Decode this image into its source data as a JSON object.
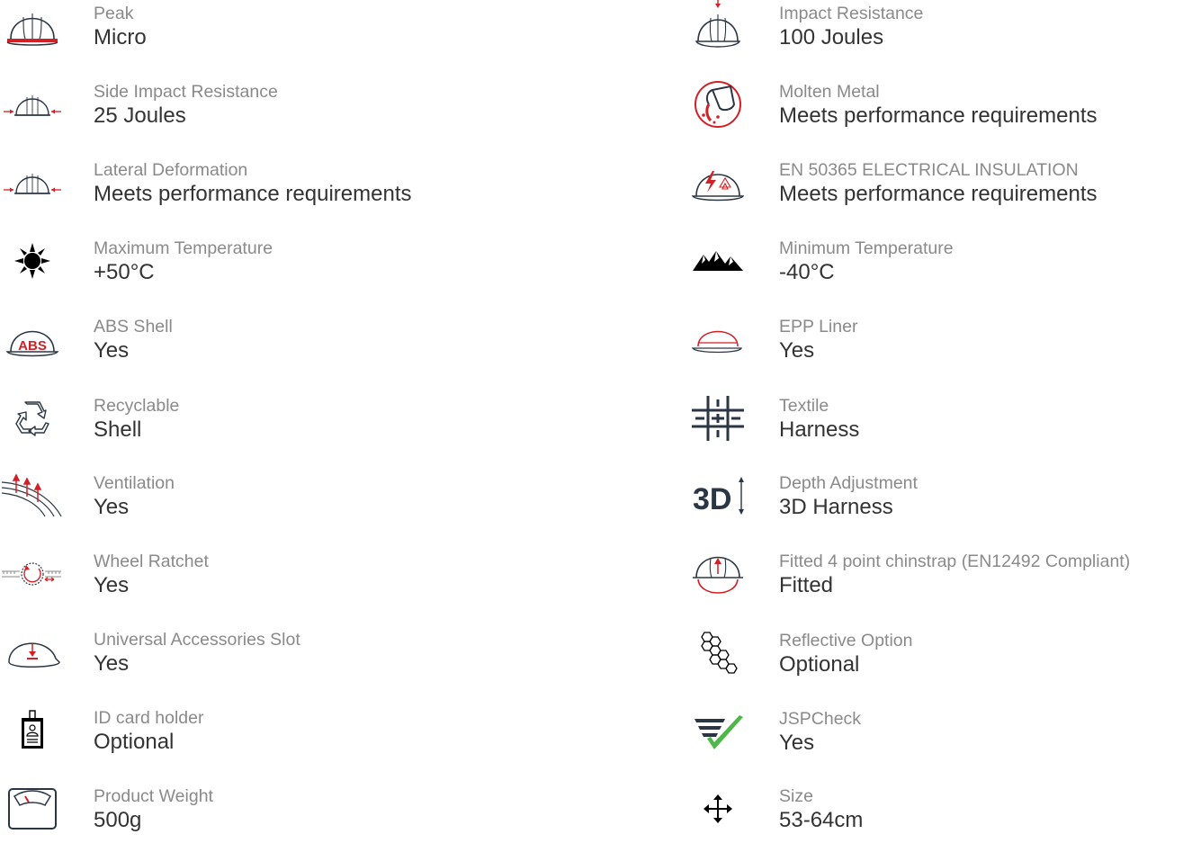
{
  "colors": {
    "accent_red": "#d31f26",
    "icon_navy": "#2b3644",
    "check_green": "#4db848",
    "label_gray": "#8a8a8a",
    "value_dark": "#333333"
  },
  "left_column": [
    {
      "icon": "helmet-peak-icon",
      "label": "Peak",
      "value": "Micro"
    },
    {
      "icon": "side-impact-icon",
      "label": "Side Impact Resistance",
      "value": "25 Joules"
    },
    {
      "icon": "lateral-deformation-icon",
      "label": "Lateral Deformation",
      "value": "Meets performance requirements"
    },
    {
      "icon": "sun-temperature-icon",
      "label": "Maximum Temperature",
      "value": "+50°C"
    },
    {
      "icon": "abs-shell-icon",
      "label": "ABS Shell",
      "value": "Yes",
      "icon_text": "ABS"
    },
    {
      "icon": "recycle-icon",
      "label": "Recyclable",
      "value": "Shell"
    },
    {
      "icon": "ventilation-icon",
      "label": "Ventilation",
      "value": "Yes"
    },
    {
      "icon": "wheel-ratchet-icon",
      "label": "Wheel Ratchet",
      "value": "Yes"
    },
    {
      "icon": "accessories-slot-icon",
      "label": "Universal Accessories Slot",
      "value": "Yes"
    },
    {
      "icon": "id-card-holder-icon",
      "label": "ID card holder",
      "value": "Optional"
    },
    {
      "icon": "weight-scale-icon",
      "label": "Product Weight",
      "value": "500g"
    }
  ],
  "right_column": [
    {
      "icon": "impact-resistance-icon",
      "label": "Impact Resistance",
      "value": "100 Joules"
    },
    {
      "icon": "molten-metal-icon",
      "label": "Molten Metal",
      "value": "Meets performance requirements"
    },
    {
      "icon": "electrical-insulation-icon",
      "label": "EN 50365 ELECTRICAL INSULATION",
      "value": "Meets performance requirements"
    },
    {
      "icon": "mountains-cold-icon",
      "label": "Minimum Temperature",
      "value": "-40°C"
    },
    {
      "icon": "epp-liner-icon",
      "label": "EPP Liner",
      "value": "Yes"
    },
    {
      "icon": "textile-icon",
      "label": "Textile",
      "value": "Harness"
    },
    {
      "icon": "depth-adjustment-3d-icon",
      "label": "Depth Adjustment",
      "value": "3D Harness",
      "icon_text": "3D"
    },
    {
      "icon": "chinstrap-icon",
      "label": "Fitted 4 point chinstrap (EN12492 Compliant)",
      "value": "Fitted"
    },
    {
      "icon": "reflective-hexagon-icon",
      "label": "Reflective Option",
      "value": "Optional"
    },
    {
      "icon": "jspcheck-icon",
      "label": "JSPCheck",
      "value": "Yes"
    },
    {
      "icon": "size-move-arrows-icon",
      "label": "Size",
      "value": "53-64cm"
    }
  ]
}
